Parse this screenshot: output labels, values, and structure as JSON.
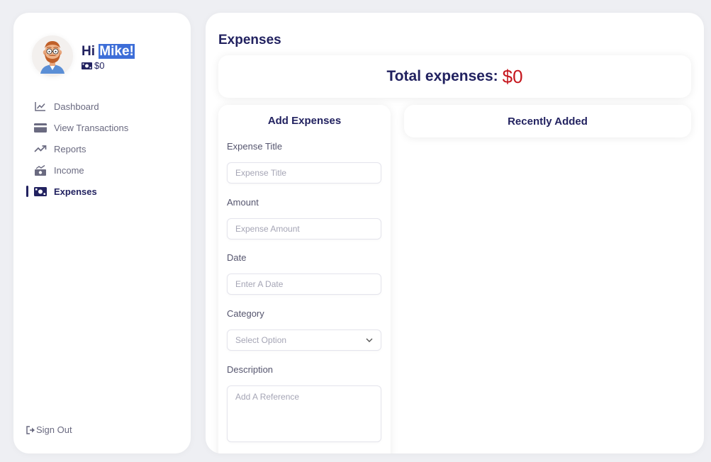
{
  "profile": {
    "greeting_prefix": "Hi",
    "name": "Mike!",
    "balance": "$0"
  },
  "nav": {
    "items": [
      {
        "label": "Dashboard",
        "icon": "chart-line-icon",
        "active": false
      },
      {
        "label": "View Transactions",
        "icon": "credit-card-icon",
        "active": false
      },
      {
        "label": "Reports",
        "icon": "trend-up-icon",
        "active": false
      },
      {
        "label": "Income",
        "icon": "money-bill-trend-icon",
        "active": false
      },
      {
        "label": "Expenses",
        "icon": "money-bill-icon",
        "active": true
      }
    ],
    "signout": "Sign Out"
  },
  "main": {
    "title": "Expenses",
    "total_label": "Total expenses:",
    "total_value": "$0"
  },
  "form": {
    "title": "Add Expenses",
    "title_label": "Expense Title",
    "title_placeholder": "Expense Title",
    "amount_label": "Amount",
    "amount_placeholder": "Expense Amount",
    "date_label": "Date",
    "date_placeholder": "Enter A Date",
    "category_label": "Category",
    "category_selected": "Select Option",
    "description_label": "Description",
    "description_placeholder": "Add A Reference"
  },
  "recent": {
    "title": "Recently Added"
  },
  "colors": {
    "background": "#eeeff3",
    "text_primary": "#222260",
    "total_value": "#c5161d",
    "highlight": "#3d6ed8"
  }
}
